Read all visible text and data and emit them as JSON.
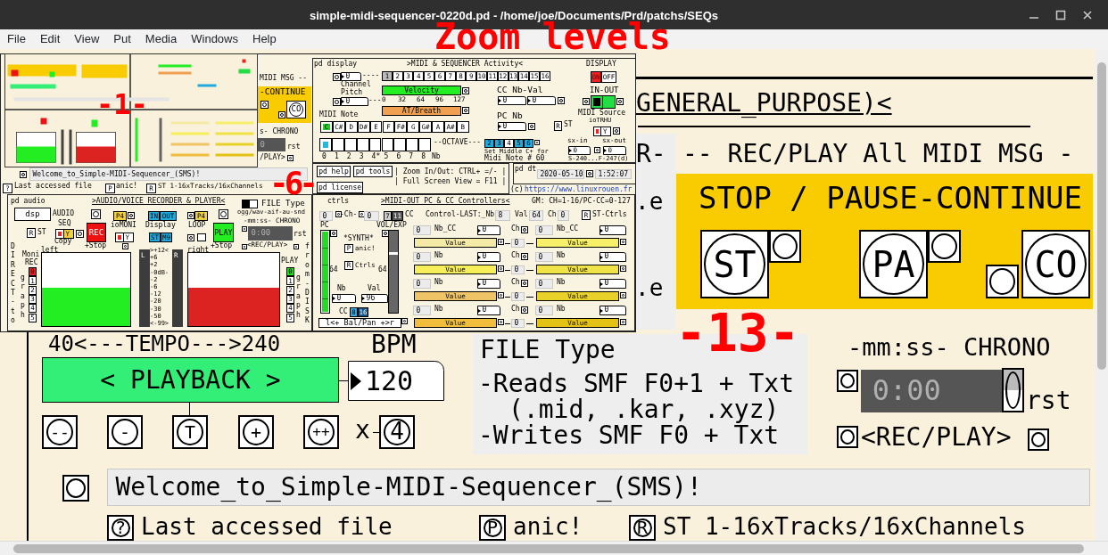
{
  "window": {
    "title": "simple-midi-sequencer-0220d.pd  - /home/joe/Documents/Prd/patchs/SEQs"
  },
  "menu": [
    "File",
    "Edit",
    "View",
    "Put",
    "Media",
    "Windows",
    "Help"
  ],
  "annotations": [
    {
      "text": "Zoom levels"
    },
    {
      "text": "-1-"
    },
    {
      "text": "-6-"
    },
    {
      "text": "-13-"
    }
  ],
  "zoom_13": {
    "items": [
      {
        "kind": "title",
        "text": "GENERAL_PURPOSE)<"
      },
      {
        "kind": "label",
        "text": "R-"
      },
      {
        "kind": "label",
        "text": "-- REC/PLAY All MIDI MSG -"
      },
      {
        "kind": "label",
        "text": ".e"
      },
      {
        "kind": "label",
        "text": ".e"
      },
      {
        "kind": "label",
        "text": "STOP / PAUSE-CONTINUE"
      },
      {
        "kind": "round",
        "text": "ST"
      },
      {
        "kind": "round",
        "text": "PA"
      },
      {
        "kind": "round",
        "text": "CO"
      },
      {
        "kind": "label",
        "text": "40<---TEMPO--->240"
      },
      {
        "kind": "label",
        "text": "BPM"
      },
      {
        "kind": "button",
        "text": "< PLAYBACK >",
        "color": "#33ee77"
      },
      {
        "kind": "number",
        "text": "120"
      },
      {
        "kind": "round",
        "text": "--"
      },
      {
        "kind": "round",
        "text": "-"
      },
      {
        "kind": "round",
        "text": "T"
      },
      {
        "kind": "round",
        "text": "+"
      },
      {
        "kind": "round",
        "text": "++"
      },
      {
        "kind": "label",
        "text": "x"
      },
      {
        "kind": "round",
        "text": "4"
      },
      {
        "kind": "label",
        "text": "FILE Type"
      },
      {
        "kind": "label",
        "text": "-Reads SMF F0+1 + Txt"
      },
      {
        "kind": "label",
        "text": "(.mid, .kar, .xyz)"
      },
      {
        "kind": "label",
        "text": "-Writes SMF F0 + Txt"
      },
      {
        "kind": "label",
        "text": "-mm:ss- CHRONO"
      },
      {
        "kind": "display",
        "text": "0:00"
      },
      {
        "kind": "label",
        "text": "rst"
      },
      {
        "kind": "label",
        "text": "<REC/PLAY>"
      },
      {
        "kind": "comment",
        "text": "Welcome_to_Simple-MIDI-Sequencer_(SMS)!"
      },
      {
        "kind": "round",
        "text": "?"
      },
      {
        "kind": "label",
        "text": "Last accessed file"
      },
      {
        "kind": "round",
        "text": "P"
      },
      {
        "kind": "label",
        "text": "anic!"
      },
      {
        "kind": "round",
        "text": "R"
      },
      {
        "kind": "label",
        "text": "ST  1-16xTracks/16xChannels"
      }
    ]
  },
  "zoom_6": {
    "items": [
      {
        "kind": "label",
        "text": "MIDI MSG --"
      },
      {
        "kind": "label",
        "text": "-CONTINUE"
      },
      {
        "kind": "round",
        "text": "CO"
      },
      {
        "kind": "label",
        "text": "s- CHRONO"
      },
      {
        "kind": "display",
        "text": "0"
      },
      {
        "kind": "label",
        "text": "rst"
      },
      {
        "kind": "label",
        "text": "/PLAY>"
      },
      {
        "kind": "comment",
        "text": "Welcome_to_Simple-MIDI-Sequencer_(SMS)!"
      },
      {
        "kind": "button",
        "text": "?"
      },
      {
        "kind": "label",
        "text": "Last accessed file"
      },
      {
        "kind": "button",
        "text": "P"
      },
      {
        "kind": "label",
        "text": "anic!"
      },
      {
        "kind": "button",
        "text": "R"
      },
      {
        "kind": "label",
        "text": "ST  1-16xTracks/16xChannels"
      },
      {
        "kind": "label",
        "text": "pd display"
      },
      {
        "kind": "label",
        "text": ">MIDI & SEQUENCER Activity<"
      },
      {
        "kind": "number",
        "text": "0"
      },
      {
        "kind": "label",
        "text": "----"
      },
      {
        "kind": "label",
        "text": "DISPLAY"
      },
      {
        "kind": "label",
        "text": "Channel"
      },
      {
        "kind": "label",
        "text": "Pitch"
      },
      {
        "kind": "number",
        "text": "0"
      },
      {
        "kind": "label",
        "text": "---"
      },
      {
        "kind": "bar",
        "text": "Velocity",
        "color": "#22ee22"
      },
      {
        "kind": "bar",
        "text": "AT/Breath",
        "color": "#f0a050"
      },
      {
        "kind": "label",
        "text": "CC Nb-Val"
      },
      {
        "kind": "number",
        "text": "0"
      },
      {
        "kind": "number",
        "text": "0"
      },
      {
        "kind": "label",
        "text": "IN-OUT"
      },
      {
        "kind": "label",
        "text": "MIDI Note"
      },
      {
        "kind": "label",
        "text": "MIDI Source"
      },
      {
        "kind": "label",
        "text": "PC Nb"
      },
      {
        "kind": "number",
        "text": "0"
      },
      {
        "kind": "button",
        "text": "R"
      },
      {
        "kind": "label",
        "text": "ST"
      },
      {
        "kind": "label",
        "text": "ioTRHU"
      },
      {
        "kind": "label",
        "text": "--OCTAVE---"
      },
      {
        "kind": "label",
        "text": "Set Middle C+ for"
      },
      {
        "kind": "label",
        "text": "Midi Note # 60"
      },
      {
        "kind": "label",
        "text": "sx-in"
      },
      {
        "kind": "label",
        "text": "sx-out"
      },
      {
        "kind": "number",
        "text": "0"
      },
      {
        "kind": "number",
        "text": "0"
      },
      {
        "kind": "label",
        "text": "S-240...F-247(d)"
      },
      {
        "kind": "label",
        "text": "Nb"
      },
      {
        "kind": "button",
        "text": "pd help"
      },
      {
        "kind": "button",
        "text": "pd tools"
      },
      {
        "kind": "button",
        "text": "pd license"
      },
      {
        "kind": "label",
        "text": "| Zoom In/Out: CTRL+ =/- |"
      },
      {
        "kind": "label",
        "text": "| Full Screen View = F11 |"
      },
      {
        "kind": "label",
        "text": "pd dt"
      },
      {
        "kind": "comment",
        "text": "2020-05-10"
      },
      {
        "kind": "comment",
        "text": "1:52:07"
      },
      {
        "kind": "label",
        "text": "(c)"
      },
      {
        "kind": "link",
        "text": "https://www.linuxrouen.fr"
      },
      {
        "kind": "label",
        "text": "pd audio"
      },
      {
        "kind": "title",
        "text": ">AUDIO/VOICE RECORDER & PLAYER<"
      },
      {
        "kind": "label",
        "text": "FILE Type"
      },
      {
        "kind": "label",
        "text": "ogg/wav-aif-au-snd"
      },
      {
        "kind": "label",
        "text": "-mm:ss- CHRONO"
      },
      {
        "kind": "display",
        "text": "0:00"
      },
      {
        "kind": "label",
        "text": "rst"
      },
      {
        "kind": "label",
        "text": "<REC/PLAY>"
      },
      {
        "kind": "button",
        "text": "dsp"
      },
      {
        "kind": "label",
        "text": "AUDIO"
      },
      {
        "kind": "label",
        "text": "SEQ"
      },
      {
        "kind": "button",
        "text": "R"
      },
      {
        "kind": "label",
        "text": "ST"
      },
      {
        "kind": "vertical",
        "text": "DIRECT-to"
      },
      {
        "kind": "label",
        "text": "left"
      },
      {
        "kind": "label",
        "text": "Copy"
      },
      {
        "kind": "button",
        "text": "REC",
        "color": "#ee1111"
      },
      {
        "kind": "label",
        "text": "+Stop"
      },
      {
        "kind": "button",
        "text": "P4",
        "color": "#f0d040"
      },
      {
        "kind": "label",
        "text": "ioMONI"
      },
      {
        "kind": "button",
        "text": "IN",
        "color": "#22aadd"
      },
      {
        "kind": "button",
        "text": "OUT",
        "color": "#22aadd"
      },
      {
        "kind": "label",
        "text": "Display"
      },
      {
        "kind": "button",
        "text": "ST",
        "color": "#22aadd"
      },
      {
        "kind": "button",
        "text": "M9",
        "color": "#22aadd"
      },
      {
        "kind": "button",
        "text": "P4",
        "color": "#f0d040"
      },
      {
        "kind": "label",
        "text": "LOOP"
      },
      {
        "kind": "button",
        "text": "PLAY",
        "color": "#22ee22"
      },
      {
        "kind": "label",
        "text": "right"
      },
      {
        "kind": "label",
        "text": "+Stop"
      },
      {
        "kind": "label",
        "text": "Moni"
      },
      {
        "kind": "label",
        "text": "REC"
      },
      {
        "kind": "vertical",
        "text": "graph"
      },
      {
        "kind": "label",
        "text": "L"
      },
      {
        "kind": "label",
        "text": "R"
      },
      {
        "kind": "label",
        "text": "PLAY"
      },
      {
        "kind": "vertical",
        "text": "graph"
      },
      {
        "kind": "vertical",
        "text": "from-DISK"
      },
      {
        "kind": "label",
        "text": "ctrls"
      },
      {
        "kind": "title",
        "text": ">MIDI-OUT PC & CC Controllers<"
      },
      {
        "kind": "label",
        "text": "GM: CH=1-16/PC-CC=0-127"
      },
      {
        "kind": "comment",
        "text": "0"
      },
      {
        "kind": "label",
        "text": "-Ch-"
      },
      {
        "kind": "comment",
        "text": "0"
      },
      {
        "kind": "label",
        "text": "CC"
      },
      {
        "kind": "label",
        "text": "Control-LAST:_Nb"
      },
      {
        "kind": "comment",
        "text": "8"
      },
      {
        "kind": "label",
        "text": "Val"
      },
      {
        "kind": "comment",
        "text": "64"
      },
      {
        "kind": "label",
        "text": "Ch"
      },
      {
        "kind": "comment",
        "text": "0"
      },
      {
        "kind": "button",
        "text": "R"
      },
      {
        "kind": "label",
        "text": "ST-Ctrls"
      },
      {
        "kind": "label",
        "text": "PC"
      },
      {
        "kind": "label",
        "text": "VOL/EXP"
      },
      {
        "kind": "label",
        "text": "*SYNTH*"
      },
      {
        "kind": "button",
        "text": "P"
      },
      {
        "kind": "label",
        "text": "anic!"
      },
      {
        "kind": "button",
        "text": "R"
      },
      {
        "kind": "label",
        "text": "Ctrls"
      },
      {
        "kind": "label",
        "text": "64"
      },
      {
        "kind": "label",
        "text": "64"
      },
      {
        "kind": "label",
        "text": "Nb"
      },
      {
        "kind": "label",
        "text": "Val"
      },
      {
        "kind": "number",
        "text": "0"
      },
      {
        "kind": "number",
        "text": "96"
      },
      {
        "kind": "label",
        "text": "CC"
      },
      {
        "kind": "button",
        "text": "l<+ Bal/Pan +>r"
      }
    ],
    "channels": [
      {
        "text": "1",
        "selected": true
      },
      {
        "text": "2",
        "selected": false
      },
      {
        "text": "3",
        "selected": false
      },
      {
        "text": "4",
        "selected": false
      },
      {
        "text": "5",
        "selected": false
      },
      {
        "text": "6",
        "selected": false
      },
      {
        "text": "7",
        "selected": false
      },
      {
        "text": "8",
        "selected": false
      },
      {
        "text": "9",
        "selected": false
      },
      {
        "text": "10",
        "selected": false
      },
      {
        "text": "11",
        "selected": false
      },
      {
        "text": "12",
        "selected": false
      },
      {
        "text": "13",
        "selected": false
      },
      {
        "text": "14",
        "selected": false
      },
      {
        "text": "15",
        "selected": false
      },
      {
        "text": "16",
        "selected": false
      }
    ],
    "display_toggle": [
      {
        "text": "ON",
        "selected": true
      },
      {
        "text": "OFF",
        "selected": false
      }
    ],
    "velocity_ticks": [
      "0",
      "32",
      "64",
      "96",
      "127"
    ],
    "notes": [
      {
        "text": "C",
        "selected": true
      },
      {
        "text": "C#",
        "selected": false
      },
      {
        "text": "D",
        "selected": false
      },
      {
        "text": "D#",
        "selected": false
      },
      {
        "text": "E",
        "selected": false
      },
      {
        "text": "F",
        "selected": false
      },
      {
        "text": "F#",
        "selected": false
      },
      {
        "text": "G",
        "selected": false
      },
      {
        "text": "G#",
        "selected": false
      },
      {
        "text": "A",
        "selected": false
      },
      {
        "text": "A#",
        "selected": false
      },
      {
        "text": "B",
        "selected": false
      }
    ],
    "octaves": [
      {
        "text": "0",
        "selected": true
      },
      {
        "text": "1",
        "selected": false
      },
      {
        "text": "2",
        "selected": false
      },
      {
        "text": "3",
        "selected": false
      },
      {
        "text": "4*",
        "selected": false
      },
      {
        "text": "5",
        "selected": false
      },
      {
        "text": "6",
        "selected": false
      },
      {
        "text": "7",
        "selected": false
      },
      {
        "text": "8",
        "selected": false
      }
    ],
    "octave_select": [
      {
        "text": "2",
        "selected": false
      },
      {
        "text": "3",
        "selected": false
      },
      {
        "text": "4",
        "selected": true
      },
      {
        "text": "5",
        "selected": false
      },
      {
        "text": "6",
        "selected": false
      }
    ],
    "toggles": [
      {
        "text": "Y",
        "on": true,
        "color": "#ffffff"
      },
      {
        "text": "Y",
        "on": true,
        "color": "#f0d040"
      },
      {
        "text": "Y",
        "on": true,
        "color": "#ffffff"
      }
    ],
    "rec_slots": [
      {
        "text": "0",
        "selected": true
      },
      {
        "text": "1",
        "selected": false
      },
      {
        "text": "2",
        "selected": false
      },
      {
        "text": "3",
        "selected": false
      },
      {
        "text": "4",
        "selected": false
      },
      {
        "text": "5",
        "selected": false
      }
    ],
    "play_slots": [
      {
        "text": "0",
        "selected": true
      },
      {
        "text": "1",
        "selected": false
      },
      {
        "text": "2",
        "selected": false
      },
      {
        "text": "3",
        "selected": false
      },
      {
        "text": "4",
        "selected": false
      },
      {
        "text": "5",
        "selected": false
      }
    ],
    "in_out": {
      "on": true
    },
    "file_type_toggle": {
      "on": true
    },
    "pc_slider": {
      "level": 1
    },
    "level_scale": [
      ">+12<",
      "+6",
      "+2",
      "-0dB-",
      "-2",
      "-6",
      "-12",
      "-20",
      "-30",
      "-50",
      "<-99>"
    ],
    "volume_slider": {
      "level": 0.73
    },
    "cc_mode": [
      {
        "text": "7",
        "selected": false
      },
      {
        "text": "11",
        "selected": true
      }
    ],
    "cc_bank": [
      {
        "text": "8",
        "selected": false
      },
      {
        "text": "16",
        "selected": true
      }
    ],
    "cc_rows": [
      {
        "ch": "Ch",
        "ch_value": "0",
        "controls": [
          {
            "number": "0",
            "label": "Nb_CC",
            "value": "0",
            "bar": "Value",
            "color": "#f4eaa6"
          },
          {
            "number": "0",
            "label": "Nb_CC",
            "value": "0",
            "bar": "Value",
            "color": "#f7ef6a"
          }
        ]
      },
      {
        "ch": "Ch",
        "ch_value": "0",
        "controls": [
          {
            "number": "0",
            "label": "Nb",
            "value": "0",
            "bar": "Value",
            "color": "#f7ef5a"
          },
          {
            "number": "0",
            "label": "Nb",
            "value": "0",
            "bar": "Value",
            "color": "#efe348"
          }
        ]
      },
      {
        "ch": "Ch",
        "ch_value": "0",
        "controls": [
          {
            "number": "0",
            "label": "Nb",
            "value": "0",
            "bar": "Value",
            "color": "#efc466"
          },
          {
            "number": "0",
            "label": "Nb",
            "value": "0",
            "bar": "Value",
            "color": "#e8d22a"
          }
        ]
      },
      {
        "ch": "Ch",
        "ch_value": "0",
        "controls": [
          {
            "number": "0",
            "label": "Nb",
            "value": "0",
            "bar": "Value",
            "color": "#f0be3c"
          },
          {
            "number": "0",
            "label": "Nb",
            "value": "0",
            "bar": "Value",
            "color": "#e4c214"
          }
        ]
      }
    ]
  }
}
